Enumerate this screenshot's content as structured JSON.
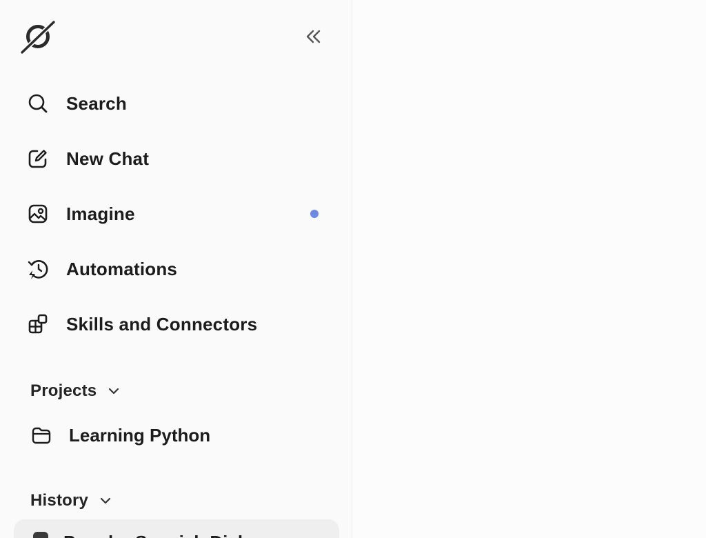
{
  "sidebar": {
    "logo_icon": "grok-logo-icon",
    "collapse_icon": "chevrons-left-icon",
    "nav": [
      {
        "label": "Search",
        "icon": "search-icon"
      },
      {
        "label": "New Chat",
        "icon": "edit-icon"
      },
      {
        "label": "Imagine",
        "icon": "image-sparkle-icon",
        "has_notification": true,
        "notification_color": "#6a8ae6"
      },
      {
        "label": "Automations",
        "icon": "history-bolt-icon"
      },
      {
        "label": "Skills and Connectors",
        "icon": "grid-add-icon"
      }
    ],
    "projects": {
      "header": "Projects",
      "items": [
        {
          "label": "Learning Python",
          "icon": "folder-icon"
        }
      ]
    },
    "history": {
      "header": "History",
      "items": [
        {
          "label": "Popular Spanish Dishes"
        }
      ]
    }
  },
  "colors": {
    "sidebar_bg": "#fafafa",
    "main_bg": "#fcfcfc",
    "accent_dot": "#6a8ae6",
    "text": "#1c1c1c"
  }
}
